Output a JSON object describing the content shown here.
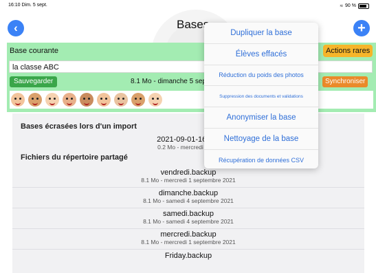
{
  "status": {
    "time": "16:10",
    "date": "Dim. 5 sept.",
    "battery": "90 %"
  },
  "header": {
    "title": "Bases"
  },
  "current": {
    "label": "Base courante",
    "class_name": "la classe ABC",
    "save_label": "Sauvegarder",
    "save_info": "8.1 Mo - dimanche 5 sep",
    "actions_label": "Actions rares",
    "sync_label": "Synchroniser",
    "avatar_count": 9
  },
  "list": {
    "section1": "Bases écrasées lors d'un import",
    "import_item": {
      "name": "2021-09-01-16-02-",
      "meta": "0.2 Mo - mercredi 1 sep"
    },
    "section2": "Fichiers du répertoire partagé",
    "shared_items": [
      {
        "name": "vendredi.backup",
        "meta": "8.1 Mo - mercredi 1 septembre 2021"
      },
      {
        "name": "dimanche.backup",
        "meta": "8.1 Mo - samedi 4 septembre 2021"
      },
      {
        "name": "samedi.backup",
        "meta": "8.1 Mo - samedi 4 septembre 2021"
      },
      {
        "name": "mercredi.backup",
        "meta": "8.1 Mo - mercredi 1 septembre 2021"
      },
      {
        "name": "Friday.backup",
        "meta": ""
      }
    ]
  },
  "menu": {
    "items": [
      "Dupliquer la base",
      "Élèves effacés",
      "Réduction du poids des photos",
      "Suppression des documents et validations",
      "Anonymiser la base",
      "Nettoyage de la base",
      "Récupération de données CSV"
    ]
  },
  "icons": {
    "back": "chevron-left-icon",
    "add": "plus-icon",
    "wifi": "wifi-icon",
    "battery": "battery-icon"
  },
  "colors": {
    "accent": "#3b82f6",
    "panel_green": "#a3ecb2",
    "save_green": "#3aa64a",
    "actions_yellow": "#f6b52a",
    "sync_orange": "#ea8a2a",
    "menu_text": "#2f6fd8",
    "avatar_skins": [
      "#f2c49b",
      "#d9a06b",
      "#f5d2b0",
      "#e8b08a",
      "#c98c5e",
      "#f2c49b",
      "#e9c3a0",
      "#d9a06b",
      "#f5d2b0"
    ]
  }
}
